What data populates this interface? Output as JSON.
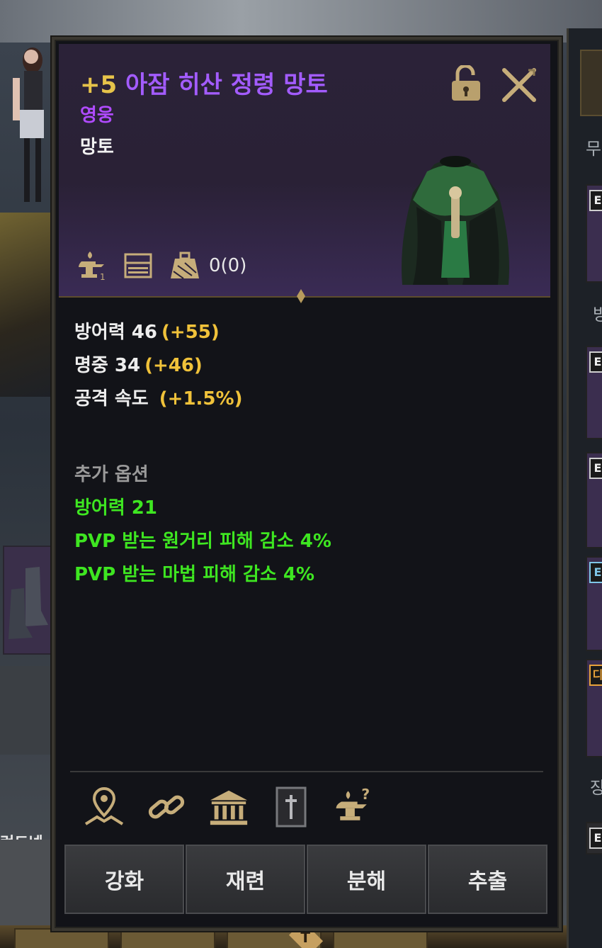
{
  "background": {
    "left_text": "런드넹",
    "right_labels": [
      "무",
      "방",
      "장"
    ],
    "right_tags": [
      "E",
      "E",
      "E",
      "E",
      "디",
      "E"
    ],
    "bottom_badge": "T"
  },
  "item": {
    "enhance": "+5",
    "name": "아잠 히산 정령 망토",
    "grade": "영웅",
    "type": "망토",
    "weight": "0(0)",
    "icons": [
      "anvil-level-icon",
      "storage-chest-icon",
      "weight-icon"
    ]
  },
  "stats": [
    {
      "label": "방어력 46",
      "bonus": "(+55)"
    },
    {
      "label": "명중 34",
      "bonus": "(+46)"
    },
    {
      "label": "공격 속도",
      "bonus": "(+1.5%)"
    }
  ],
  "extra_options": {
    "title": "추가 옵션",
    "items": [
      "방어력 21",
      "PVP 받는 원거리 피해 감소 4%",
      "PVP 받는 마법 피해 감소 4%"
    ]
  },
  "action_icons": [
    "location-pin-icon",
    "chain-link-icon",
    "bank-building-icon",
    "codex-book-icon",
    "anvil-question-icon"
  ],
  "buttons": {
    "enhance": "강화",
    "refine": "재련",
    "disassemble": "분해",
    "extract": "추출"
  },
  "colors": {
    "enhance": "#e6c34a",
    "name": "#a35cff",
    "grade": "#b04bff",
    "bonus": "#f0c23a",
    "option": "#3ee621",
    "header_bg": "#2b2238"
  }
}
